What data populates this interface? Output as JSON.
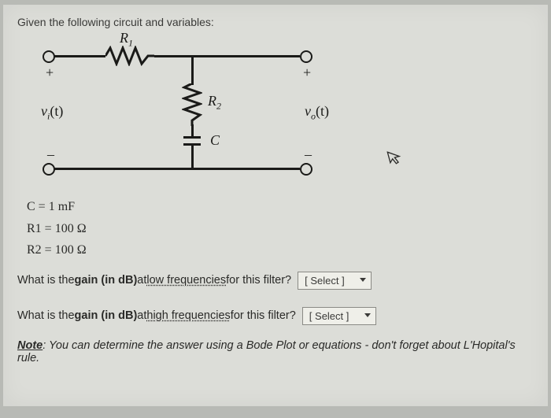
{
  "prompt": "Given the following circuit and variables:",
  "circuit": {
    "R1": "R",
    "R1sub": "1",
    "R2": "R",
    "R2sub": "2",
    "C": "C",
    "vi": "v",
    "vi_sub": "i",
    "vi_arg": "(t)",
    "vo": "v",
    "vo_sub": "o",
    "vo_arg": "(t)"
  },
  "vars": {
    "c": "C = 1 mF",
    "r1": "R1 = 100 Ω",
    "r2": "R2 = 100 Ω"
  },
  "q1": {
    "pre": "What is the ",
    "bold": "gain (in dB)",
    "mid": "at ",
    "u": "low frequencies",
    "post": " for this filter?"
  },
  "q2": {
    "pre": "What is the ",
    "bold": "gain (in dB)",
    "mid": " at ",
    "u": "high frequencies",
    "post": " for this filter?"
  },
  "select_placeholder": "[ Select ]",
  "note": {
    "label": "Note",
    "text": ": You can determine the answer using a Bode Plot or equations - don't forget about L'Hopital's rule."
  }
}
